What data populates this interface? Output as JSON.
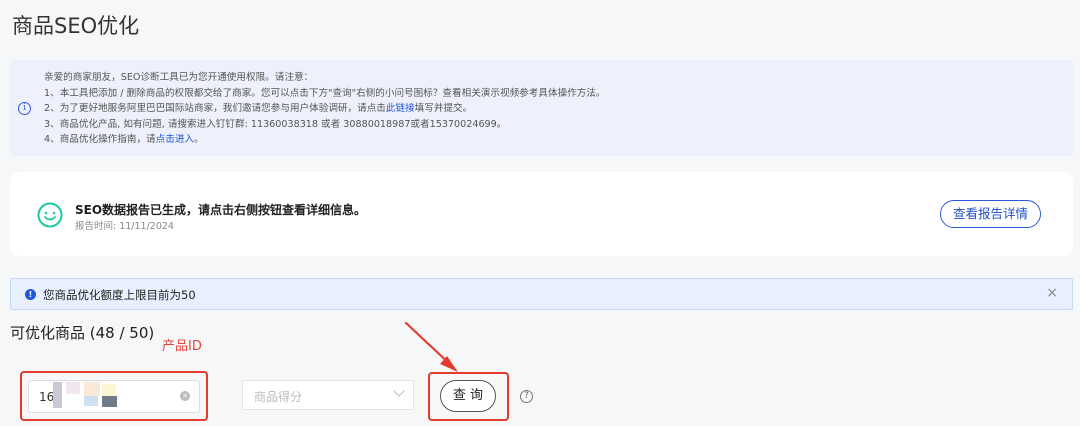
{
  "page": {
    "title": "商品SEO优化"
  },
  "notice": {
    "line0": "亲爱的商家朋友，SEO诊断工具已为您开通使用权限。请注意：",
    "line1": "1、本工具把添加 / 删除商品的权限都交给了商家。您可以点击下方\"查询\"右侧的小问号图标？查看相关演示视频参考具体操作方法。",
    "line2_pre": "2、为了更好地服务阿里巴巴国际站商家，我们邀请您参与用户体验调研，请点击",
    "line2_link": "此链接",
    "line2_post": "填写并提交。",
    "line3": "3、商品优化产品, 如有问题, 请搜索进入钉钉群: 11360038318 或者 30880018987或者15370024699。",
    "line4_pre": "4、商品优化操作指南，请",
    "line4_link": "点击进入",
    "line4_post": "。"
  },
  "report": {
    "title": "SEO数据报告已生成，请点击右侧按钮查看详细信息。",
    "time": "报告时间: 11/11/2024",
    "button": "查看报告详情"
  },
  "quota": {
    "text": "您商品优化额度上限目前为50",
    "close": "×"
  },
  "section": {
    "title": "可优化商品 (48 / 50)",
    "annotation": "产品ID"
  },
  "filters": {
    "product_id_value": "16",
    "score_placeholder": "商品得分",
    "query_button": "查 询",
    "help": "?"
  },
  "colors": {
    "accent": "#2a5bd6",
    "annotation": "#e33b2e",
    "notice_bg": "#eef1fb"
  },
  "icons": {
    "notice": "info-icon",
    "report": "smile-icon",
    "quota": "info-icon",
    "clear": "clear-icon",
    "help": "question-icon"
  }
}
